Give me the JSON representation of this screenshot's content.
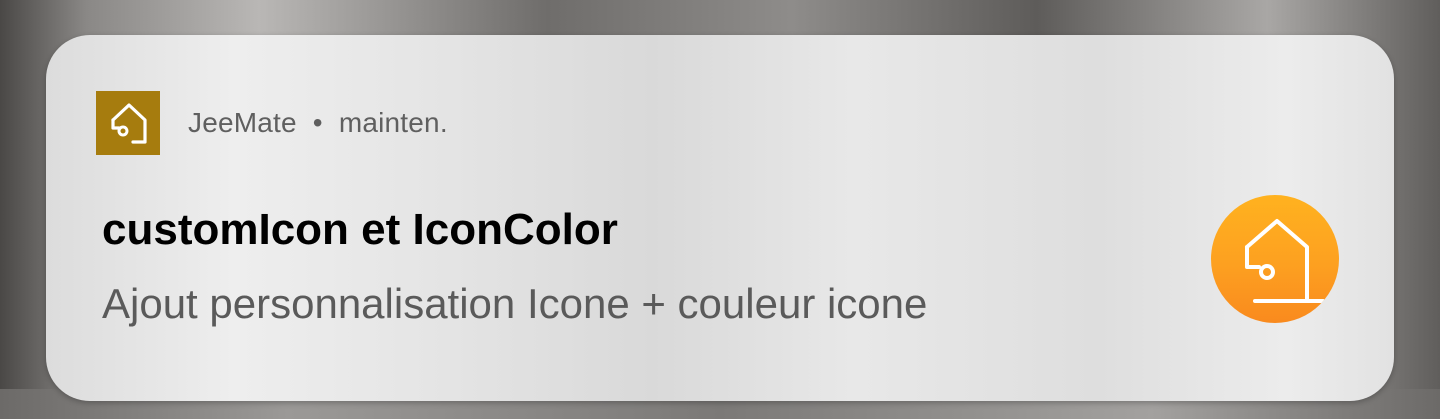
{
  "notification": {
    "app_name": "JeeMate",
    "separator": "•",
    "channel": "mainten.",
    "title": "customIcon et IconColor",
    "message": "Ajout personnalisation Icone + couleur icone",
    "small_icon": "house-icon",
    "small_icon_color": "#a67c0e",
    "large_icon": "house-icon",
    "large_icon_color": "#fda020"
  }
}
